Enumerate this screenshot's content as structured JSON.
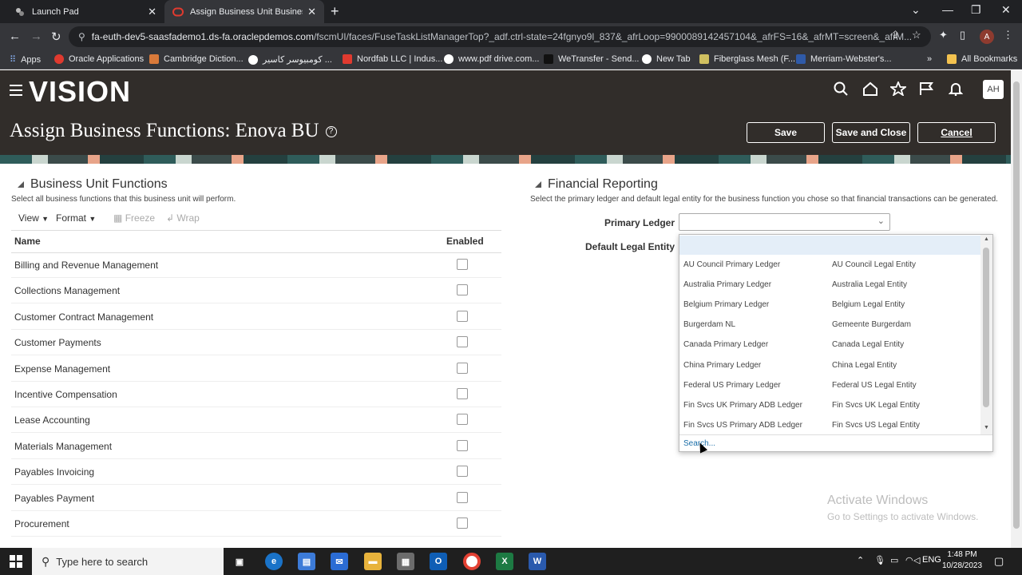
{
  "browser": {
    "tabs": [
      {
        "title": "Launch Pad"
      },
      {
        "title": "Assign Business Unit Business Fu"
      }
    ],
    "url_host": "fa-euth-dev5-saasfademo1.ds-fa.oraclepdemos.com",
    "url_path": "/fscmUI/faces/FuseTaskListManagerTop?_adf.ctrl-state=24fgnyo9l_837&_afrLoop=9900089142457104&_afrFS=16&_afrMT=screen&_afrM...",
    "profile_initial": "A",
    "bookmarks": [
      {
        "label": "Apps",
        "color": "#4285f4"
      },
      {
        "label": "Oracle Applications",
        "color": "#e03a2f"
      },
      {
        "label": "Cambridge Diction...",
        "color": "#d97a3a"
      },
      {
        "label": "كومبيوسر كاسير ...",
        "color": "#ffffff"
      },
      {
        "label": "Nordfab LLC | Indus...",
        "color": "#e03a2f"
      },
      {
        "label": "www.pdf drive.com...",
        "color": "#ffffff"
      },
      {
        "label": "WeTransfer - Send...",
        "color": "#222222"
      },
      {
        "label": "New Tab",
        "color": "#ffffff"
      },
      {
        "label": "Fiberglass Mesh (F...",
        "color": "#d0c060"
      },
      {
        "label": "Merriam-Webster's...",
        "color": "#2f5aa8"
      }
    ],
    "more_bookmarks": "»",
    "all_bookmarks": "All Bookmarks"
  },
  "app": {
    "logo": "VISION",
    "user_initials": "AH",
    "page_title": "Assign Business Functions: Enova BU",
    "buttons": {
      "save": "Save",
      "save_close": "Save and Close",
      "cancel": "Cancel"
    }
  },
  "left": {
    "title": "Business Unit Functions",
    "desc": "Select all business functions that this business unit will perform.",
    "toolbar": {
      "view": "View",
      "format": "Format",
      "freeze": "Freeze",
      "wrap": "Wrap"
    },
    "col_name": "Name",
    "col_enabled": "Enabled",
    "rows": [
      {
        "name": "Billing and Revenue Management",
        "enabled": false
      },
      {
        "name": "Collections Management",
        "enabled": false
      },
      {
        "name": "Customer Contract Management",
        "enabled": false
      },
      {
        "name": "Customer Payments",
        "enabled": false
      },
      {
        "name": "Expense Management",
        "enabled": false
      },
      {
        "name": "Incentive Compensation",
        "enabled": false
      },
      {
        "name": "Lease Accounting",
        "enabled": false
      },
      {
        "name": "Materials Management",
        "enabled": false
      },
      {
        "name": "Payables Invoicing",
        "enabled": false
      },
      {
        "name": "Payables Payment",
        "enabled": false
      },
      {
        "name": "Procurement",
        "enabled": false
      }
    ]
  },
  "right": {
    "title": "Financial Reporting",
    "desc": "Select the primary ledger and default legal entity for the business function you chose so that financial transactions can be generated.",
    "primary_ledger_label": "Primary Ledger",
    "primary_ledger_value": "",
    "default_le_label": "Default Legal Entity",
    "dropdown": [
      {
        "ledger": "AU Council Primary Ledger",
        "entity": "AU Council Legal Entity"
      },
      {
        "ledger": "Australia Primary Ledger",
        "entity": "Australia Legal Entity"
      },
      {
        "ledger": "Belgium Primary Ledger",
        "entity": "Belgium Legal Entity"
      },
      {
        "ledger": "Burgerdam NL",
        "entity": "Gemeente Burgerdam"
      },
      {
        "ledger": "Canada Primary Ledger",
        "entity": "Canada Legal Entity"
      },
      {
        "ledger": "China Primary Ledger",
        "entity": "China Legal Entity"
      },
      {
        "ledger": "Federal US Primary Ledger",
        "entity": "Federal US Legal Entity"
      },
      {
        "ledger": "Fin Svcs UK Primary ADB Ledger",
        "entity": "Fin Svcs UK Legal Entity"
      },
      {
        "ledger": "Fin Svcs US Primary ADB Ledger",
        "entity": "Fin Svcs US Legal Entity"
      }
    ],
    "search_link": "Search..."
  },
  "watermark": {
    "line1": "Activate Windows",
    "line2": "Go to Settings to activate Windows."
  },
  "taskbar": {
    "search_placeholder": "Type here to search",
    "lang": "ENG",
    "time": "1:48 PM",
    "date": "10/28/2023"
  }
}
